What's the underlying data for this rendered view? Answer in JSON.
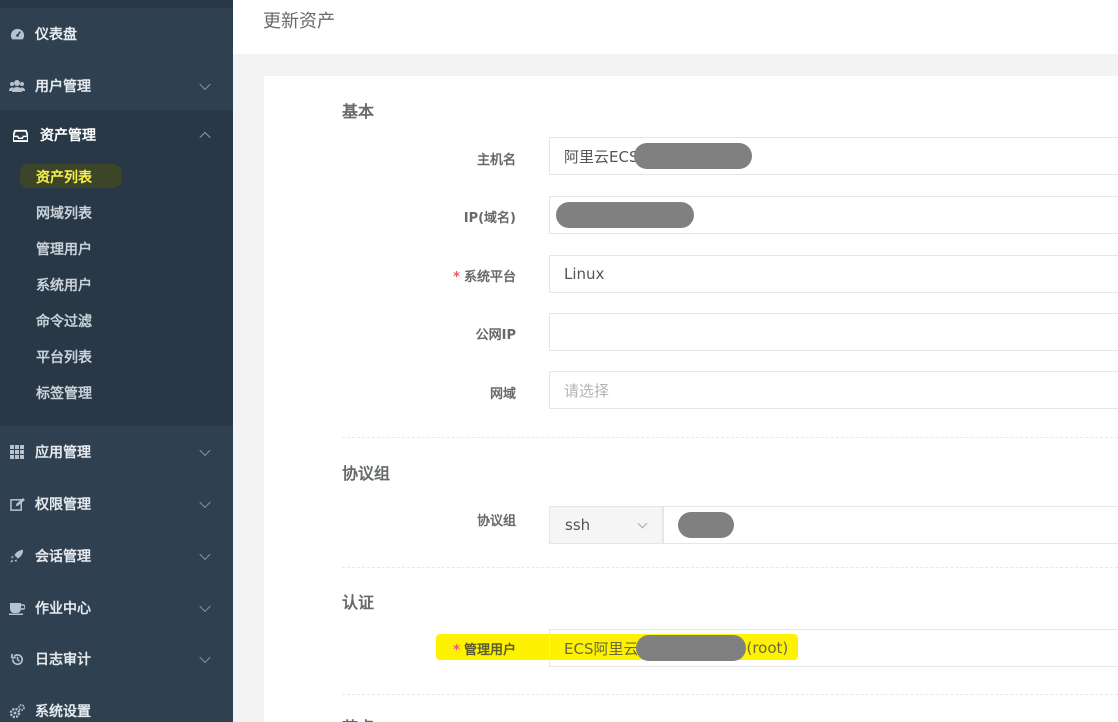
{
  "sidebar": {
    "items": [
      {
        "label": "仪表盘",
        "icon": "dashboard-icon"
      },
      {
        "label": "用户管理",
        "icon": "users-icon"
      },
      {
        "label": "资产管理",
        "icon": "inbox-icon"
      },
      {
        "label": "应用管理",
        "icon": "grid-icon"
      },
      {
        "label": "权限管理",
        "icon": "edit-icon"
      },
      {
        "label": "会话管理",
        "icon": "rocket-icon"
      },
      {
        "label": "作业中心",
        "icon": "coffee-icon"
      },
      {
        "label": "日志审计",
        "icon": "history-icon"
      },
      {
        "label": "系统设置",
        "icon": "gears-icon"
      }
    ],
    "asset_submenu": [
      "资产列表",
      "网域列表",
      "管理用户",
      "系统用户",
      "命令过滤",
      "平台列表",
      "标签管理"
    ]
  },
  "header": {
    "title": "更新资产"
  },
  "form": {
    "basic": {
      "section_title": "基本",
      "hostname_label": "主机名",
      "hostname_value": "阿里云ECS",
      "ip_label": "IP(域名)",
      "platform_label": "系统平台",
      "platform_value": "Linux",
      "public_ip_label": "公网IP",
      "domain_label": "网域",
      "domain_placeholder": "请选择"
    },
    "protocols": {
      "section_title": "协议组",
      "label": "协议组",
      "protocol_value": "ssh"
    },
    "auth": {
      "section_title": "认证",
      "admin_user_label": "管理用户",
      "admin_user_prefix": "ECS阿里云",
      "admin_user_suffix": "(root)"
    },
    "next_section_title": "节点",
    "required_mark": "*"
  },
  "colors": {
    "sidebar_bg": "#2f4050",
    "submenu_bg": "#293846",
    "highlight": "#fff200",
    "required": "#ed5565"
  }
}
